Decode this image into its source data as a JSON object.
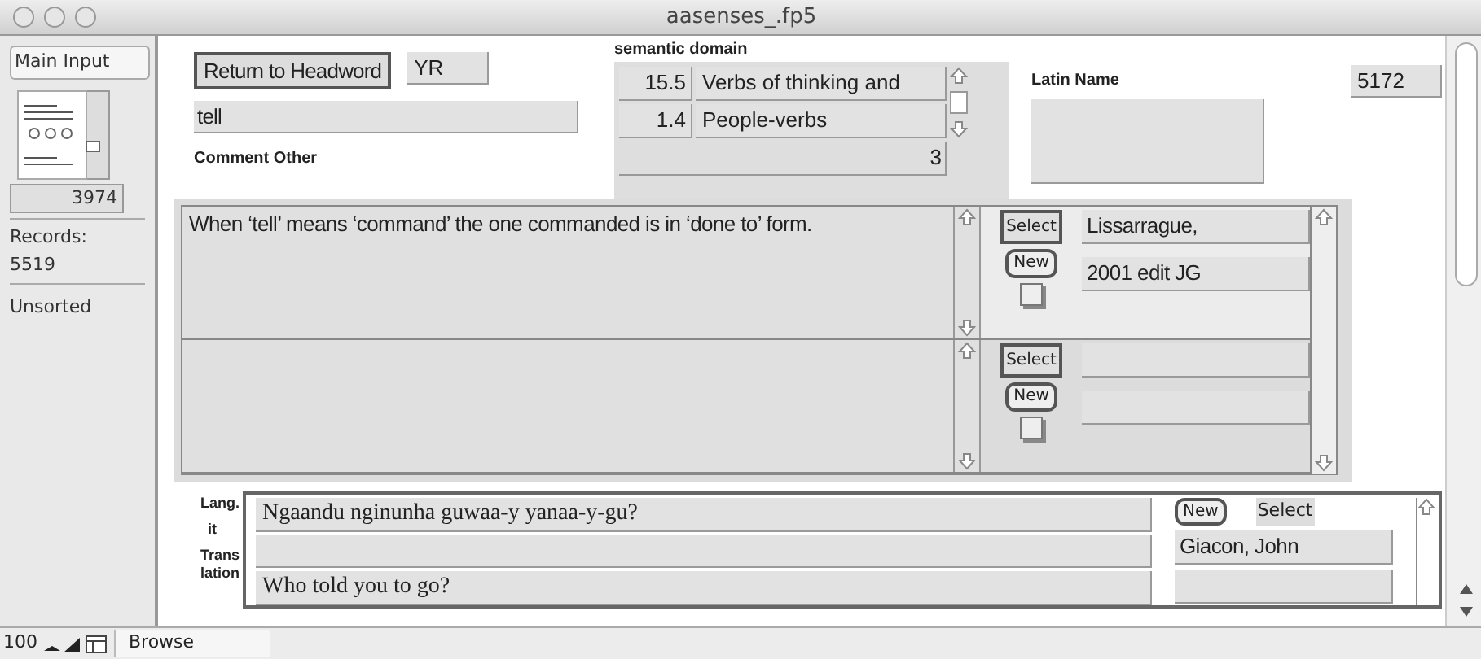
{
  "window": {
    "title": "aasenses_.fp5"
  },
  "sidebar": {
    "layout_button": "Main Input",
    "record_number": "3974",
    "records_label": "Records:",
    "records_count": "5519",
    "sort_status": "Unsorted"
  },
  "header": {
    "return_button": "Return to Headword",
    "code": "YR",
    "headword": "tell",
    "comment_label": "Comment Other"
  },
  "semantic_domain": {
    "label": "semantic domain",
    "rows": [
      {
        "number": "15.5",
        "name": "Verbs of thinking and"
      },
      {
        "number": "1.4",
        "name": "People-verbs"
      }
    ],
    "count": "3"
  },
  "latin_name": {
    "label": "Latin Name"
  },
  "record_id": "5172",
  "comments": [
    {
      "selected": true,
      "text": "When ‘tell’ means ‘command’ the one commanded is in ‘done to’ form.",
      "select_button": "Select",
      "new_button": "New",
      "checked": false,
      "sources": [
        "Lissarrague,",
        "2001 edit JG"
      ]
    },
    {
      "selected": false,
      "select_button": "Select",
      "new_button": "New",
      "checked": false
    }
  ],
  "example": {
    "labels": [
      "Lang.",
      "it",
      "Trans",
      "lation"
    ],
    "fields": [
      {
        "kind": "filled",
        "text": "Ngaandu nginunha guwaa-y yanaa-y-gu?"
      },
      {
        "kind": "blank"
      },
      {
        "kind": "filled",
        "text": "Who told you to go?"
      }
    ],
    "new_button": "New",
    "select_label": "Select",
    "sources": [
      {
        "kind": "filled",
        "text": "Giacon, John"
      },
      {
        "kind": "blank"
      }
    ]
  },
  "status_bar": {
    "zoom": "100",
    "mode": "Browse"
  }
}
